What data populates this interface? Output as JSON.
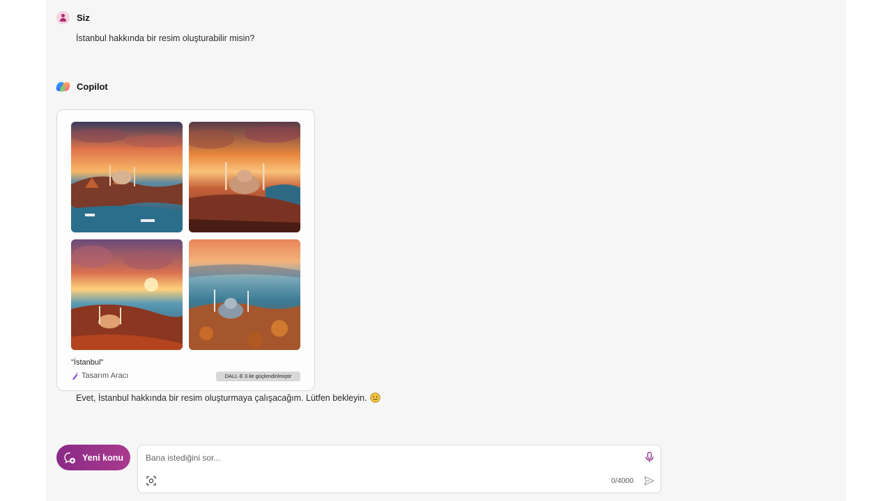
{
  "colors": {
    "panel_bg": "#f6f6f6",
    "accent": "#8a2a86",
    "avatar_bg": "#f5d5e0",
    "badge_bg": "#d8d8d8"
  },
  "user_message": {
    "sender": "Siz",
    "text": "İstanbul hakkında bir resim oluşturabilir misin?",
    "avatar_icon": "user-avatar-icon"
  },
  "copilot_message": {
    "sender": "Copilot",
    "logo_icon": "copilot-logo-icon",
    "image_card": {
      "images": [
        {
          "name": "istanbul-image-1"
        },
        {
          "name": "istanbul-image-2"
        },
        {
          "name": "istanbul-image-3"
        },
        {
          "name": "istanbul-image-4"
        }
      ],
      "caption": "\"İstanbul\"",
      "tool_label": "Tasarım Aracı",
      "tool_icon": "wand-icon",
      "badge": "DALL·E 3 ile güçlendirilmiştir"
    },
    "text": "Evet, İstanbul hakkında bir resim oluşturmaya çalışacağım. Lütfen bekleyin.",
    "emoji_icon": "smile-emoji-icon"
  },
  "composer": {
    "new_topic_label": "Yeni konu",
    "new_topic_icon": "new-chat-icon",
    "placeholder": "Bana istediğini sor...",
    "value": "",
    "char_count": "0/4000",
    "mic_icon": "microphone-icon",
    "scan_icon": "visual-search-icon",
    "send_icon": "send-icon"
  }
}
